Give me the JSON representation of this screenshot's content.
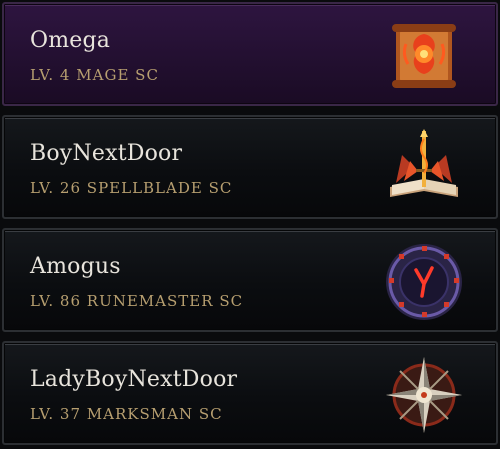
{
  "characters": [
    {
      "name": "Omega",
      "level_label": "LV. 4",
      "class": "MAGE",
      "realm": "SC",
      "icon": "mage-scroll-icon",
      "selected": true
    },
    {
      "name": "BoyNextDoor",
      "level_label": "LV. 26",
      "class": "SPELLBLADE",
      "realm": "SC",
      "icon": "spellblade-sword-book-icon",
      "selected": false
    },
    {
      "name": "Amogus",
      "level_label": "LV. 86",
      "class": "RUNEMASTER",
      "realm": "SC",
      "icon": "runemaster-rune-circle-icon",
      "selected": false
    },
    {
      "name": "LadyBoyNextDoor",
      "level_label": "LV. 37",
      "class": "MARKSMAN",
      "realm": "SC",
      "icon": "marksman-compass-star-icon",
      "selected": false
    }
  ],
  "colors": {
    "selected_bg": "#2a1339",
    "card_bg": "#0f1114",
    "name_text": "#e8e4dc",
    "sub_text": "#b79f70"
  }
}
